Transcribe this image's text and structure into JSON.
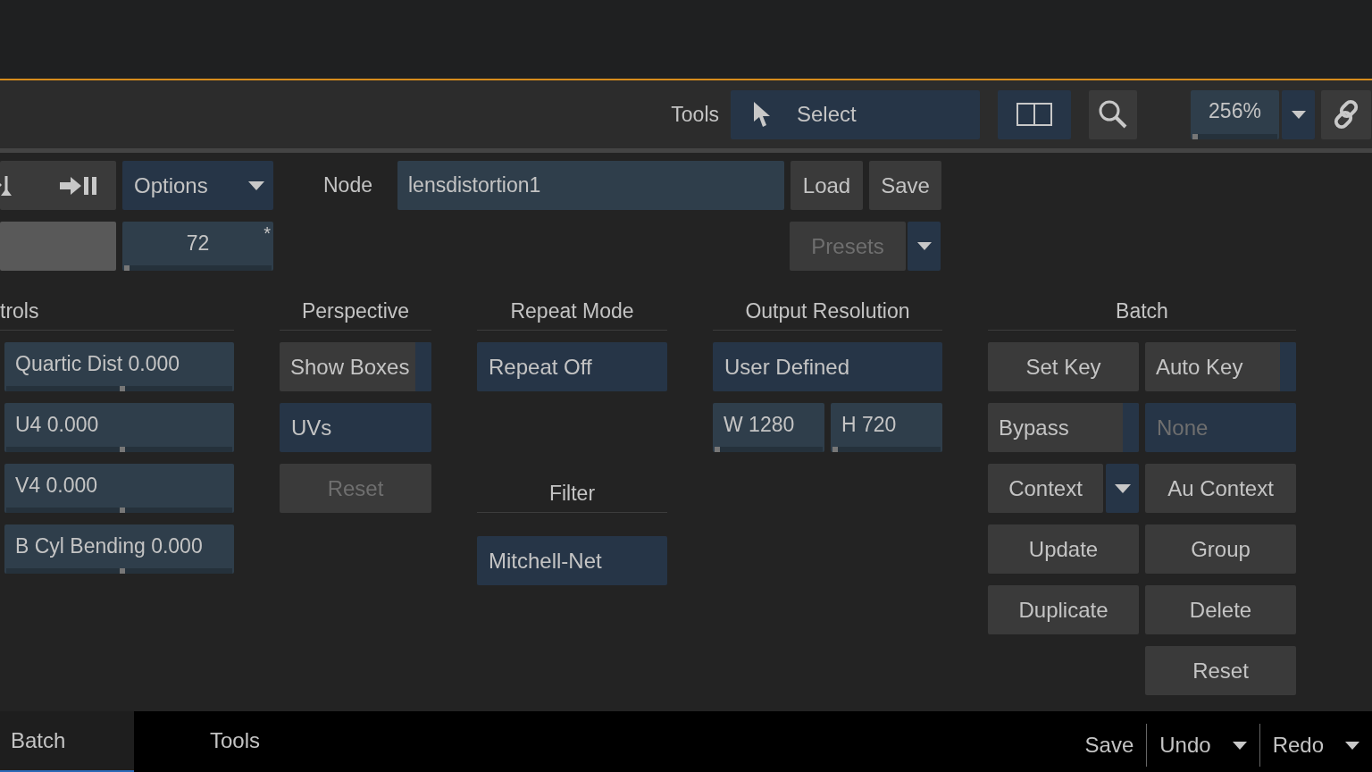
{
  "toolbar": {
    "label": "Tools",
    "select": "Select",
    "zoom": {
      "value": "256%",
      "level": 0
    }
  },
  "node_row": {
    "options": "Options",
    "node_label": "Node",
    "node_value": "lensdistortion1",
    "buttons": [
      "Load",
      "Save"
    ]
  },
  "frame_field": {
    "value": "72",
    "marker": "*",
    "level": 0
  },
  "presets": {
    "label": "Presets",
    "disabled": true
  },
  "sections": [
    {
      "title": "trols",
      "columns": [
        [
          {
            "kind": "slider",
            "label": "Quartic Dist 0.000",
            "level": 0.5
          },
          {
            "kind": "slider",
            "label": "U4 0.000",
            "level": 0.5
          },
          {
            "kind": "slider",
            "label": "V4 0.000",
            "level": 0.5
          },
          {
            "kind": "slider",
            "label": "B Cyl Bending 0.000",
            "level": 0.5
          }
        ]
      ]
    },
    {
      "title": "Perspective",
      "columns": [
        [
          {
            "kind": "toggle",
            "label": "Show Boxes",
            "on": false
          },
          {
            "kind": "menu",
            "label": "UVs",
            "disabled": false
          },
          {
            "kind": "button",
            "label": "Reset",
            "disabled": true
          }
        ]
      ]
    },
    {
      "title": "Repeat Mode",
      "columns": [
        [
          {
            "kind": "menu",
            "label": "Repeat Off",
            "disabled": false
          },
          {
            "kind": "header",
            "label": "Filter"
          },
          {
            "kind": "menu",
            "label": "Mitchell-Net",
            "disabled": false
          }
        ]
      ]
    },
    {
      "title": "Output Resolution",
      "columns": [
        [
          {
            "kind": "menu",
            "label": "User Defined",
            "disabled": false
          },
          {
            "kind": "pair",
            "fields": [
              {
                "label": "W 1280",
                "level": 0
              },
              {
                "label": "H 720",
                "level": 0
              }
            ]
          }
        ]
      ]
    },
    {
      "title": "Batch",
      "columns": [
        [
          {
            "kind": "button",
            "label": "Set Key",
            "disabled": false
          },
          {
            "kind": "toggle",
            "label": "Bypass",
            "on": false
          },
          {
            "kind": "dropdown",
            "label": "Context"
          },
          {
            "kind": "button",
            "label": "Update",
            "disabled": false
          },
          {
            "kind": "button",
            "label": "Duplicate",
            "disabled": false
          }
        ],
        [
          {
            "kind": "toggle",
            "label": "Auto Key",
            "on": false
          },
          {
            "kind": "menu",
            "label": "None",
            "disabled": true
          },
          {
            "kind": "button",
            "label": "Au Context",
            "disabled": false
          },
          {
            "kind": "button",
            "label": "Group",
            "disabled": false
          },
          {
            "kind": "button",
            "label": "Delete",
            "disabled": false
          },
          {
            "kind": "button",
            "label": "Reset",
            "disabled": false
          }
        ]
      ]
    }
  ],
  "tabs": [
    {
      "label": "Batch",
      "selected": true
    },
    {
      "label": "Tools",
      "selected": false
    }
  ],
  "actions": [
    {
      "label": "Save",
      "menu": false
    },
    {
      "label": "Undo",
      "menu": true
    },
    {
      "label": "Redo",
      "menu": true
    }
  ]
}
